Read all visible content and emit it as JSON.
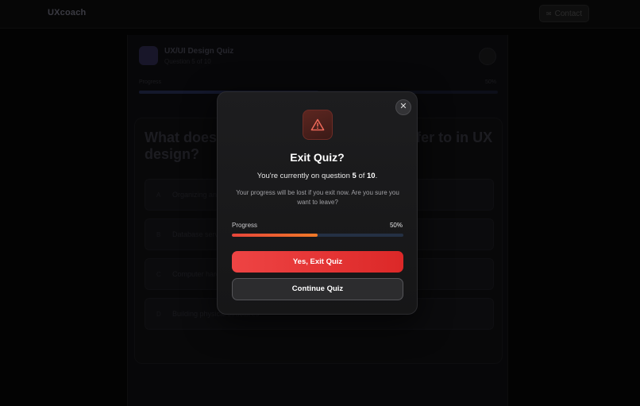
{
  "header": {
    "brand": "UXcoach",
    "contact_label": "Contact"
  },
  "quiz": {
    "title": "UX/UI Design Quiz",
    "subtitle": "Question 5 of 10",
    "progress_label": "Progress",
    "progress_percent": "50%",
    "question": "What does \"information architecture\" refer to in UX design?",
    "options": [
      {
        "letter": "A",
        "text": "Organizing and structuring content"
      },
      {
        "letter": "B",
        "text": "Database server architecture"
      },
      {
        "letter": "C",
        "text": "Computer hardware design"
      },
      {
        "letter": "D",
        "text": "Building physical structures"
      }
    ]
  },
  "modal": {
    "title": "Exit Quiz?",
    "line_prefix": "You're currently on question ",
    "current_question": "5",
    "line_middle": " of ",
    "total_questions": "10",
    "line_suffix": ".",
    "description": "Your progress will be lost if you exit now. Are you sure you want to leave?",
    "progress_label": "Progress",
    "progress_percent": "50%",
    "progress_fraction": 0.5,
    "exit_label": "Yes, Exit Quiz",
    "continue_label": "Continue Quiz",
    "close_glyph": "✕"
  },
  "colors": {
    "accent_red": "#ef4444",
    "progress_orange": "#f07a28",
    "warning_bg": "#4a1f1b"
  }
}
